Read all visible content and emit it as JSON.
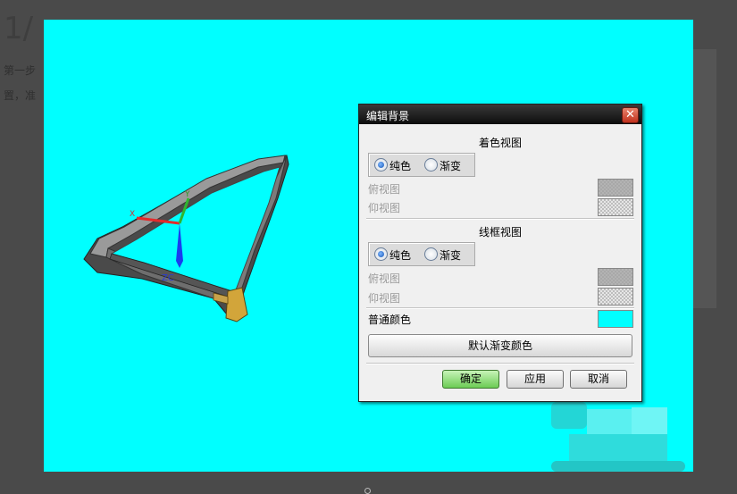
{
  "background_page": {
    "heading": "1/",
    "line1": "第一步",
    "line2": "置，准"
  },
  "viewport": {
    "axis_labels": {
      "x": "X",
      "y": "Y",
      "z": "ZC"
    },
    "colors": {
      "background": "#00ffff"
    }
  },
  "dialog": {
    "title": "编辑背景",
    "close_icon": "close-icon",
    "shaded_view": {
      "title": "着色视图",
      "options": [
        "纯色",
        "渐变"
      ],
      "selected": "纯色",
      "top_view_label": "俯视图",
      "bottom_view_label": "仰视图"
    },
    "wireframe_view": {
      "title": "线框视图",
      "options": [
        "纯色",
        "渐变"
      ],
      "selected": "纯色",
      "top_view_label": "俯视图",
      "bottom_view_label": "仰视图"
    },
    "normal_color_label": "普通颜色",
    "normal_color_value": "#00ffff",
    "default_gradient_button": "默认渐变颜色",
    "ok_button": "确定",
    "apply_button": "应用",
    "cancel_button": "取消"
  }
}
